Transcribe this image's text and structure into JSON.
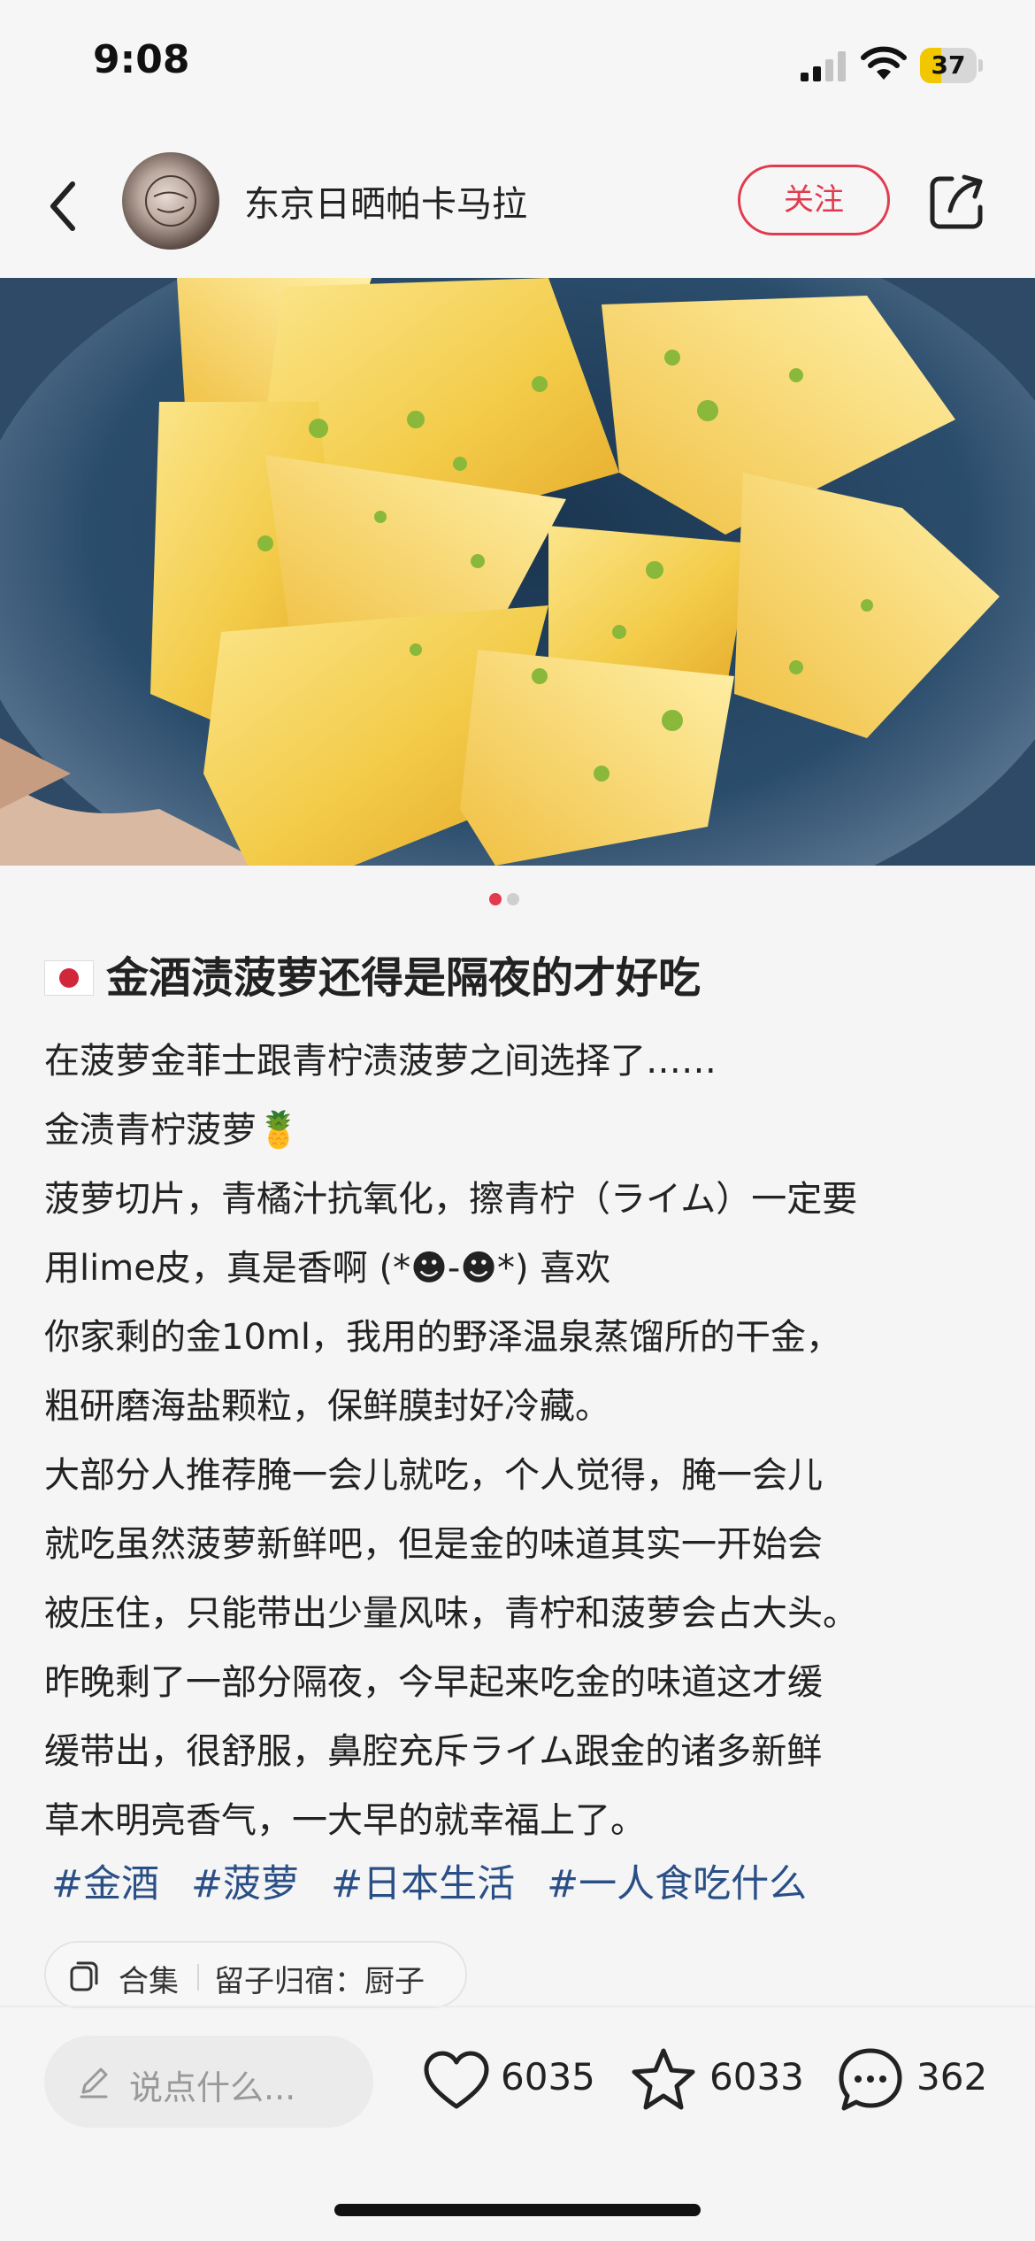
{
  "status_bar": {
    "time": "9:08",
    "battery_level": "37",
    "battery_fraction": 0.37,
    "battery_color": "#f2c700"
  },
  "nav": {
    "back_icon": "chevron-left-icon",
    "username": "东京日晒帕卡马拉",
    "follow_label": "关注",
    "share_icon": "share-icon"
  },
  "carousel": {
    "page_count": 2,
    "current_page": 1,
    "active_color": "#e23a4e",
    "inactive_color": "#cfcfcf"
  },
  "post": {
    "title": "金酒渍菠萝还得是隔夜的才好吃",
    "title_icon": "japan-flag-emoji",
    "body_lines": [
      "在菠萝金菲士跟青柠渍菠萝之间选择了……",
      "金渍青柠菠萝🍍",
      "菠萝切片，青橘汁抗氧化，擦青柠（ライム）一定要",
      "用lime皮，真是香啊 (*☻-☻*) 喜欢",
      "你家剩的金10ml，我用的野泽温泉蒸馏所的干金，",
      "粗研磨海盐颗粒，保鲜膜封好冷藏。",
      "大部分人推荐腌一会儿就吃，个人觉得，腌一会儿",
      "就吃虽然菠萝新鲜吧，但是金的味道其实一开始会",
      "被压住，只能带出少量风味，青柠和菠萝会占大头。",
      "昨晚剩了一部分隔夜，今早起来吃金的味道这才缓",
      "缓带出，很舒服，鼻腔充斥ライム跟金的诸多新鲜",
      "草木明亮香气，一大早的就幸福上了。"
    ],
    "tags": [
      "#金酒",
      "#菠萝",
      "#日本生活",
      "#一人食吃什么"
    ],
    "tag_color": "#2a4f86"
  },
  "collection": {
    "label": "合集",
    "title": "留子归宿：厨子"
  },
  "bottom_bar": {
    "comment_placeholder": "说点什么...",
    "like_count": "6035",
    "star_count": "6033",
    "comment_count": "362"
  },
  "colors": {
    "accent": "#e23a4e",
    "tag": "#2a4f86"
  }
}
